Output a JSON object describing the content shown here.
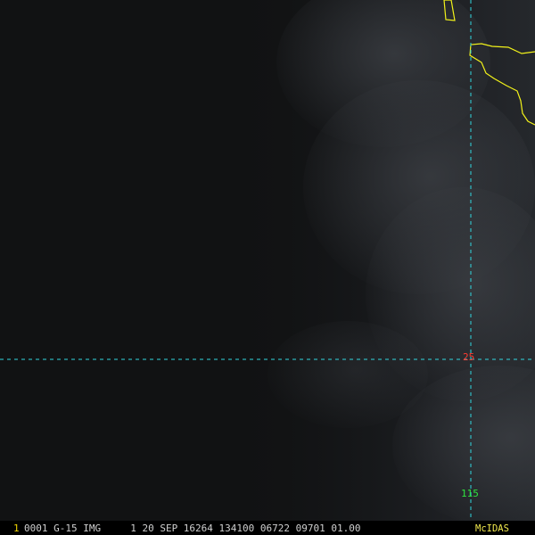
{
  "labels": {
    "latitude": "25",
    "longitude": "115"
  },
  "status_bar": {
    "frame_number": "1",
    "text": "0001 G-15 IMG     1 20 SEP 16264 134100 06722 09701 01.00",
    "brand": "McIDAS"
  },
  "colors": {
    "background": "#111213",
    "cloud_base": "#202226",
    "cloud_light": "#3a3d42",
    "grid_line": "#31d7df",
    "coastline": "#f2f21a",
    "latitude_label": "#ff3b30",
    "longitude_label": "#2fe33f",
    "frame_number": "#f0d400",
    "brand": "#f2e94e"
  }
}
